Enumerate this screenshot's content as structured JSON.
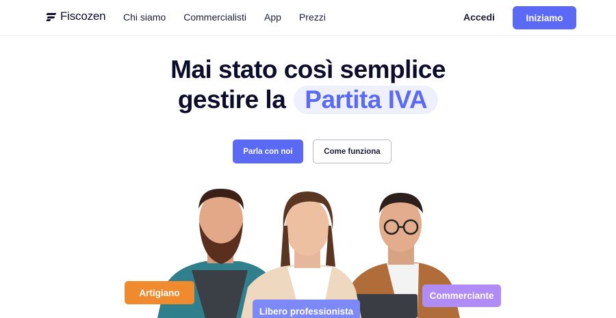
{
  "header": {
    "logo_text": "Fiscozen",
    "nav": [
      "Chi siamo",
      "Commercialisti",
      "App",
      "Prezzi"
    ],
    "login_label": "Accedi",
    "cta_label": "Iniziamo"
  },
  "hero": {
    "title_line1": "Mai stato così semplice",
    "title_line2_prefix": "gestire la",
    "title_highlight": "Partita IVA",
    "primary_button": "Parla con noi",
    "secondary_button": "Come funziona"
  },
  "people": {
    "tags": [
      "Artigiano",
      "Libero professionista",
      "Commerciante"
    ]
  },
  "colors": {
    "brand": "#5b6af5",
    "artigiano": "#ef8a2f",
    "libero": "#7d89f7",
    "commerciante": "#b08cf7"
  }
}
